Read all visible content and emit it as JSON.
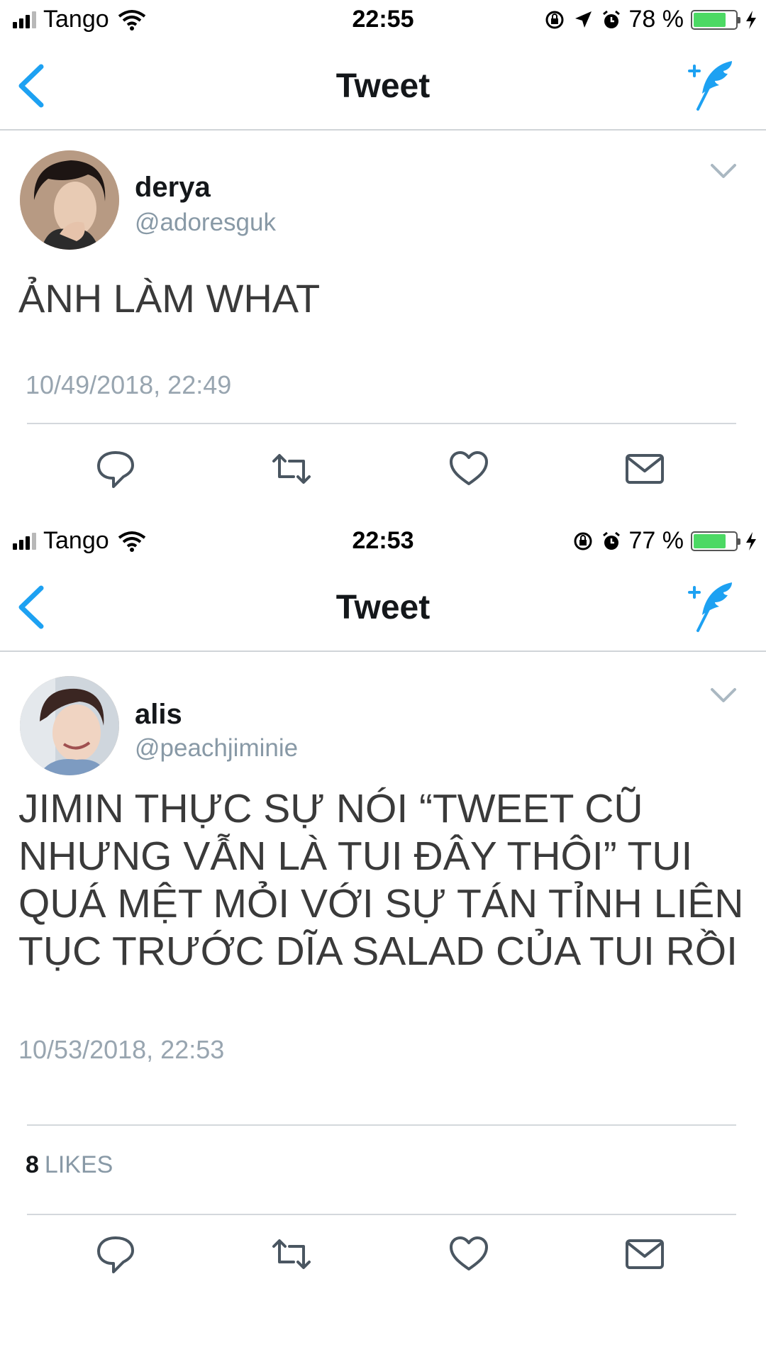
{
  "screens": [
    {
      "status": {
        "carrier": "Tango",
        "time": "22:55",
        "battery": "78 %",
        "battery_level": 0.78
      },
      "nav": {
        "title": "Tweet"
      },
      "tweet": {
        "name": "derya",
        "handle": "@adoresguk",
        "text": "ẢNH LÀM WHAT",
        "timestamp": "10/49/2018, 22:49"
      }
    },
    {
      "status": {
        "carrier": "Tango",
        "time": "22:53",
        "battery": "77 %",
        "battery_level": 0.77
      },
      "nav": {
        "title": "Tweet"
      },
      "tweet": {
        "name": "alis",
        "handle": "@peachjiminie",
        "text": "JIMIN THỰC SỰ NÓI “TWEET CŨ NHƯNG VẪN LÀ TUI ĐÂY THÔI” TUI QUÁ MỆT MỎI VỚI SỰ TÁN TỈNH LIÊN TỤC TRƯỚC DĨA SALAD CỦA TUI RỒI",
        "timestamp": "10/53/2018, 22:53",
        "likes_count": "8",
        "likes_label": "LIKES"
      }
    }
  ],
  "icons": {
    "status": [
      "signal-icon",
      "wifi-icon",
      "rotation-lock-icon",
      "location-icon",
      "alarm-icon",
      "battery-icon",
      "charging-icon"
    ],
    "nav": [
      "back-chevron-icon",
      "compose-tweet-icon"
    ],
    "actions": [
      "reply-icon",
      "retweet-icon",
      "like-icon",
      "dm-icon",
      "caret-down-icon"
    ]
  },
  "colors": {
    "twitter_blue": "#1da1f2",
    "gray_text": "#8899a6",
    "battery_green": "#4cd964"
  }
}
